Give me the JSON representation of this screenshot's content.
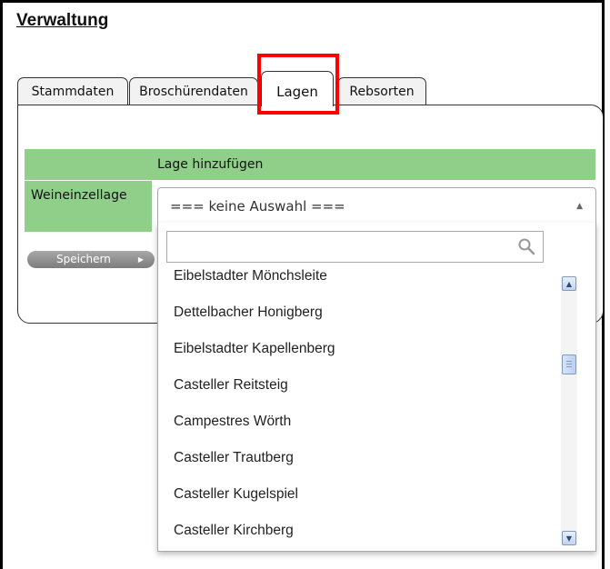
{
  "page": {
    "title": "Verwaltung"
  },
  "tabs": [
    {
      "label": "Stammdaten",
      "active": false
    },
    {
      "label": "Broschürendaten",
      "active": false
    },
    {
      "label": "Lagen",
      "active": true
    },
    {
      "label": "Rebsorten",
      "active": false
    }
  ],
  "form": {
    "section_header": "Lage hinzufügen",
    "field_label": "Weineinzellage",
    "select_value": "=== keine Auswahl ===",
    "save_label": "Speichern"
  },
  "dropdown": {
    "search_value": "",
    "search_placeholder": "",
    "options": [
      "Eibelstadter Mönchsleite",
      "Dettelbacher Honigberg",
      "Eibelstadter Kapellenberg",
      "Casteller Reitsteig",
      "Campestres Wörth",
      "Casteller Trautberg",
      "Casteller Kugelspiel",
      "Casteller Kirchberg"
    ]
  },
  "colors": {
    "header_green": "#8fcf8a",
    "highlight_red": "#ff0000",
    "button_gray": "#8c8c8c"
  },
  "icons": {
    "search": "search-icon",
    "select_arrow": "chevron-up-icon",
    "button_arrow": "triangle-right-icon",
    "scroll_up": "scroll-up-icon",
    "scroll_down": "scroll-down-icon"
  }
}
